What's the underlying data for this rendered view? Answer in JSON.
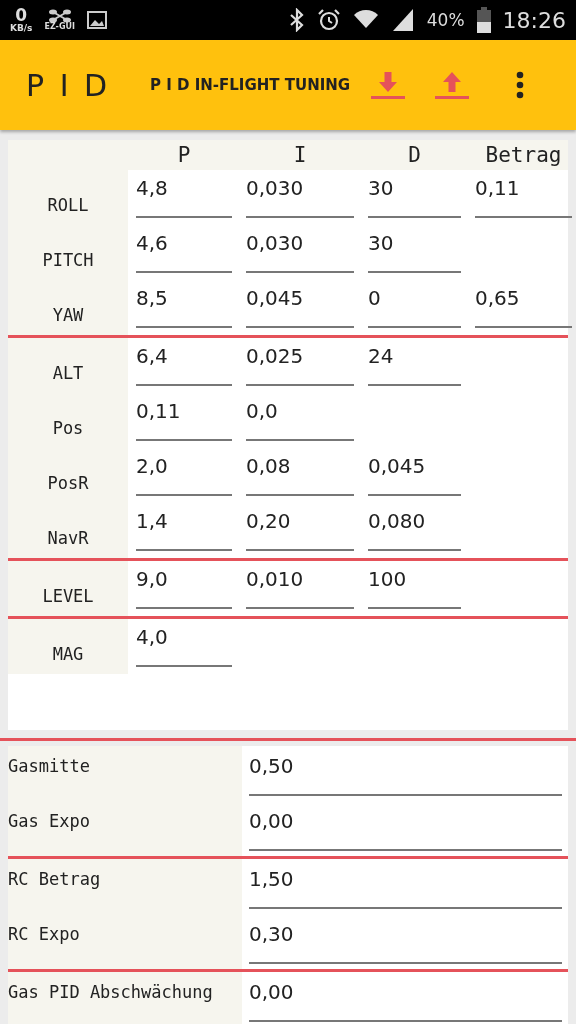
{
  "status_bar": {
    "speed": "0",
    "speed_unit": "KB/s",
    "app_label": "EZ-GUI",
    "battery": "40%",
    "time": "18:26"
  },
  "toolbar": {
    "title": "P I D",
    "subtitle": "P I D IN-FLIGHT TUNING"
  },
  "pid_table": {
    "columns": [
      "P",
      "I",
      "D",
      "Betrag"
    ],
    "groups": [
      {
        "rows": [
          {
            "label": "ROLL",
            "values": {
              "p": "4,8",
              "i": "0,030",
              "d": "30",
              "betrag": "0,11"
            }
          },
          {
            "label": "PITCH",
            "values": {
              "p": "4,6",
              "i": "0,030",
              "d": "30"
            }
          },
          {
            "label": "YAW",
            "values": {
              "p": "8,5",
              "i": "0,045",
              "d": "0",
              "betrag": "0,65"
            }
          }
        ]
      },
      {
        "rows": [
          {
            "label": "ALT",
            "values": {
              "p": "6,4",
              "i": "0,025",
              "d": "24"
            }
          },
          {
            "label": "Pos",
            "values": {
              "p": "0,11",
              "i": "0,0"
            }
          },
          {
            "label": "PosR",
            "values": {
              "p": "2,0",
              "i": "0,08",
              "d": "0,045"
            }
          },
          {
            "label": "NavR",
            "values": {
              "p": "1,4",
              "i": "0,20",
              "d": "0,080"
            }
          }
        ]
      },
      {
        "rows": [
          {
            "label": "LEVEL",
            "values": {
              "p": "9,0",
              "i": "0,010",
              "d": "100"
            }
          }
        ]
      },
      {
        "rows": [
          {
            "label": "MAG",
            "values": {
              "p": "4,0"
            }
          }
        ]
      }
    ]
  },
  "settings": {
    "groups": [
      {
        "rows": [
          {
            "label": "Gasmitte",
            "value": "0,50"
          },
          {
            "label": "Gas Expo",
            "value": "0,00"
          }
        ]
      },
      {
        "rows": [
          {
            "label": "RC Betrag",
            "value": "1,50"
          },
          {
            "label": "RC Expo",
            "value": "0,30"
          }
        ]
      },
      {
        "rows": [
          {
            "label": "Gas PID Abschwächung",
            "value": "0,00"
          }
        ]
      }
    ]
  }
}
